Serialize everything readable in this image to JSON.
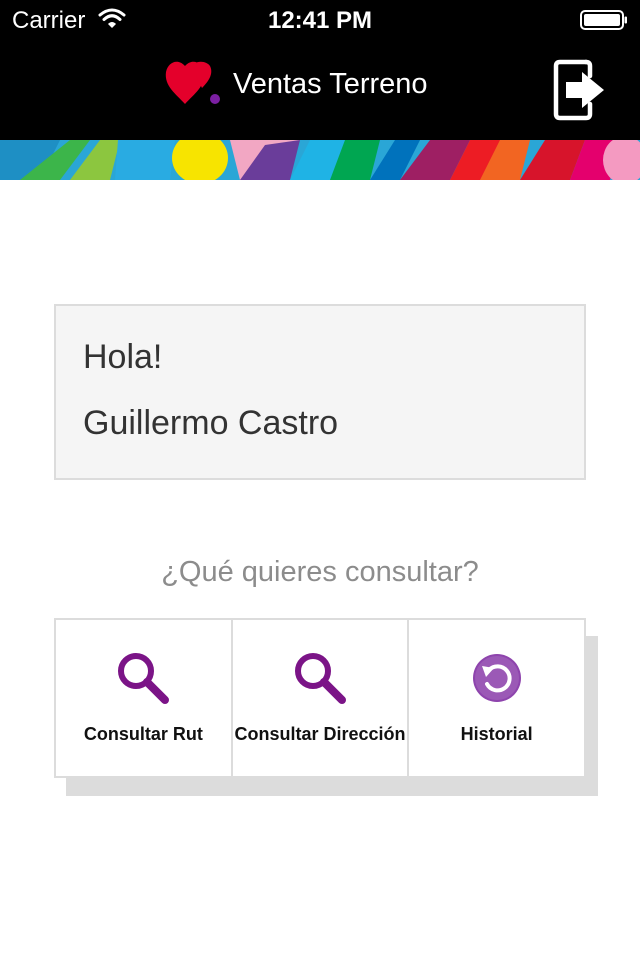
{
  "status_bar": {
    "carrier": "Carrier",
    "time": "12:41 PM",
    "wifi_icon": "wifi-icon",
    "battery_icon": "battery-icon"
  },
  "nav_bar": {
    "logo_icon": "heart-brand-logo",
    "title": "Ventas Terreno",
    "logout_icon": "logout-icon"
  },
  "greeting": {
    "hello": "Hola!",
    "name": "Guillermo Castro"
  },
  "question": "¿Qué quieres consultar?",
  "actions": [
    {
      "label": "Consultar Rut",
      "icon": "search-icon"
    },
    {
      "label": "Consultar Dirección",
      "icon": "search-icon"
    },
    {
      "label": "Historial",
      "icon": "history-icon"
    }
  ],
  "colors": {
    "nav_background": "#000000",
    "brand_red": "#e4002b",
    "accent_purple": "#7b1fa2",
    "card_background": "#f5f5f5",
    "question_text": "#8c8c8c"
  }
}
